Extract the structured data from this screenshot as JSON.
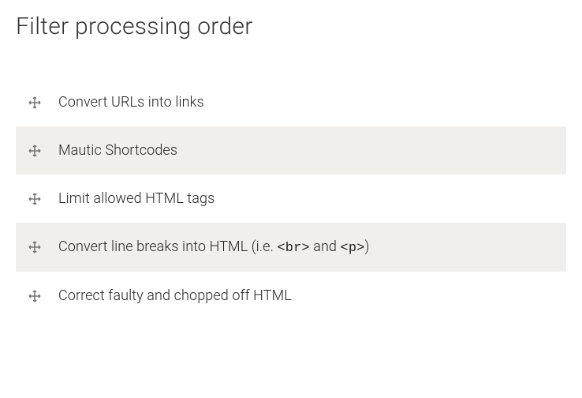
{
  "header": {
    "title": "Filter processing order"
  },
  "filters": [
    {
      "label": "Convert URLs into links",
      "has_code": false
    },
    {
      "label": "Mautic Shortcodes",
      "has_code": false
    },
    {
      "label": "Limit allowed HTML tags",
      "has_code": false
    },
    {
      "label_prefix": "Convert line breaks into HTML (i.e. ",
      "code1": "<br>",
      "label_mid": " and ",
      "code2": "<p>",
      "label_suffix": ")",
      "has_code": true
    },
    {
      "label": "Correct faulty and chopped off HTML",
      "has_code": false
    }
  ]
}
